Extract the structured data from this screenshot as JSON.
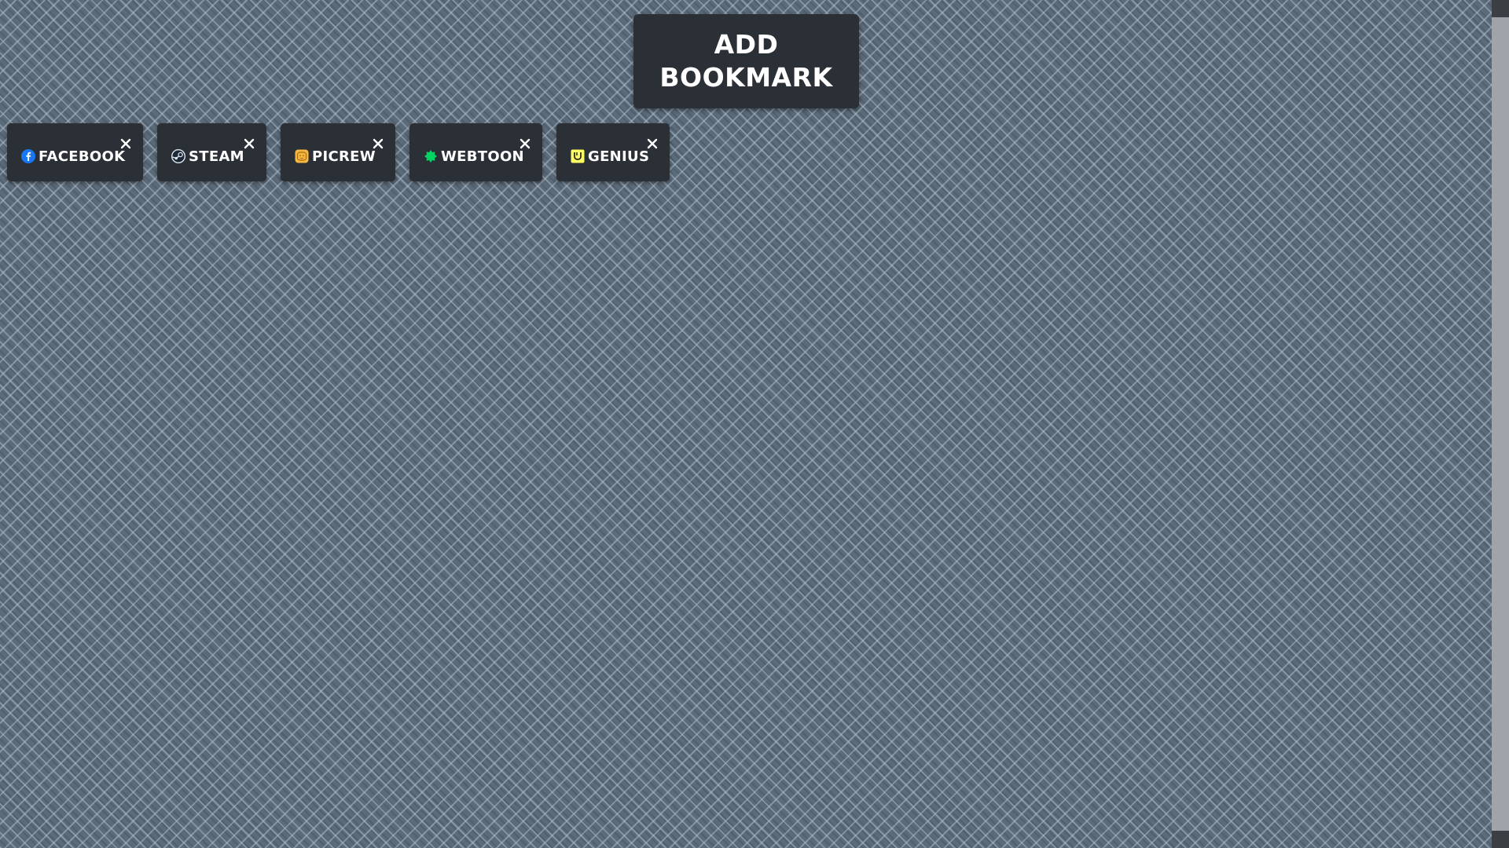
{
  "add_bookmark": {
    "line1": "ADD",
    "line2": "BOOKMARK"
  },
  "bookmarks": [
    {
      "label": "FACEBOOK",
      "icon": "facebook-icon",
      "color": "#1877f2"
    },
    {
      "label": "STEAM",
      "icon": "steam-icon",
      "color": "#1b2838"
    },
    {
      "label": "PICREW",
      "icon": "picrew-icon",
      "color": "#f5b942"
    },
    {
      "label": "WEBTOON",
      "icon": "webtoon-icon",
      "color": "#00d564"
    },
    {
      "label": "GENIUS",
      "icon": "genius-icon",
      "color": "#ffff64"
    }
  ],
  "close_icon": "close-icon"
}
